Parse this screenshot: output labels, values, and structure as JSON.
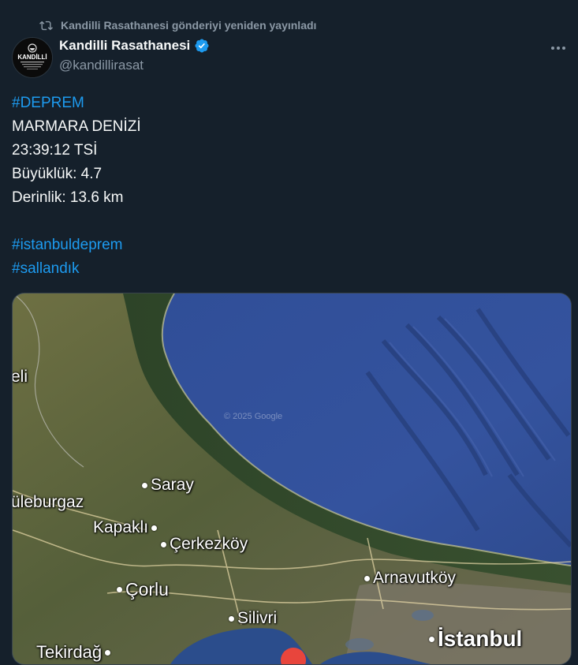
{
  "repost": {
    "text": "Kandilli Rasathanesi gönderiyi yeniden yayınladı",
    "icon": "repost-icon"
  },
  "author": {
    "name": "Kandilli Rasathanesi",
    "handle": "@kandillirasat",
    "avatar_text": "KANDİLLİ",
    "verified": true
  },
  "tweet": {
    "tag1": "#DEPREM",
    "line1": "MARMARA DENİZİ",
    "line2": "23:39:12 TSİ",
    "line3": "Büyüklük: 4.7",
    "line4": "Derinlik: 13.6 km",
    "tag2": "#istanbuldeprem",
    "tag3": "#sallandık"
  },
  "map": {
    "watermark": "© 2025 Google",
    "places": {
      "eli": "eli",
      "saray": "Saray",
      "luleburgaz": "üleburgaz",
      "kapakli": "Kapaklı",
      "cerkezkoy": "Çerkezköy",
      "corlu": "Çorlu",
      "arnavutkoy": "Arnavutköy",
      "silivri": "Silivri",
      "istanbul": "İstanbul",
      "tekirdag": "Tekirdağ"
    }
  },
  "colors": {
    "accent": "#1d9bf0",
    "background": "#15202b",
    "secondary_text": "#8b98a5"
  }
}
